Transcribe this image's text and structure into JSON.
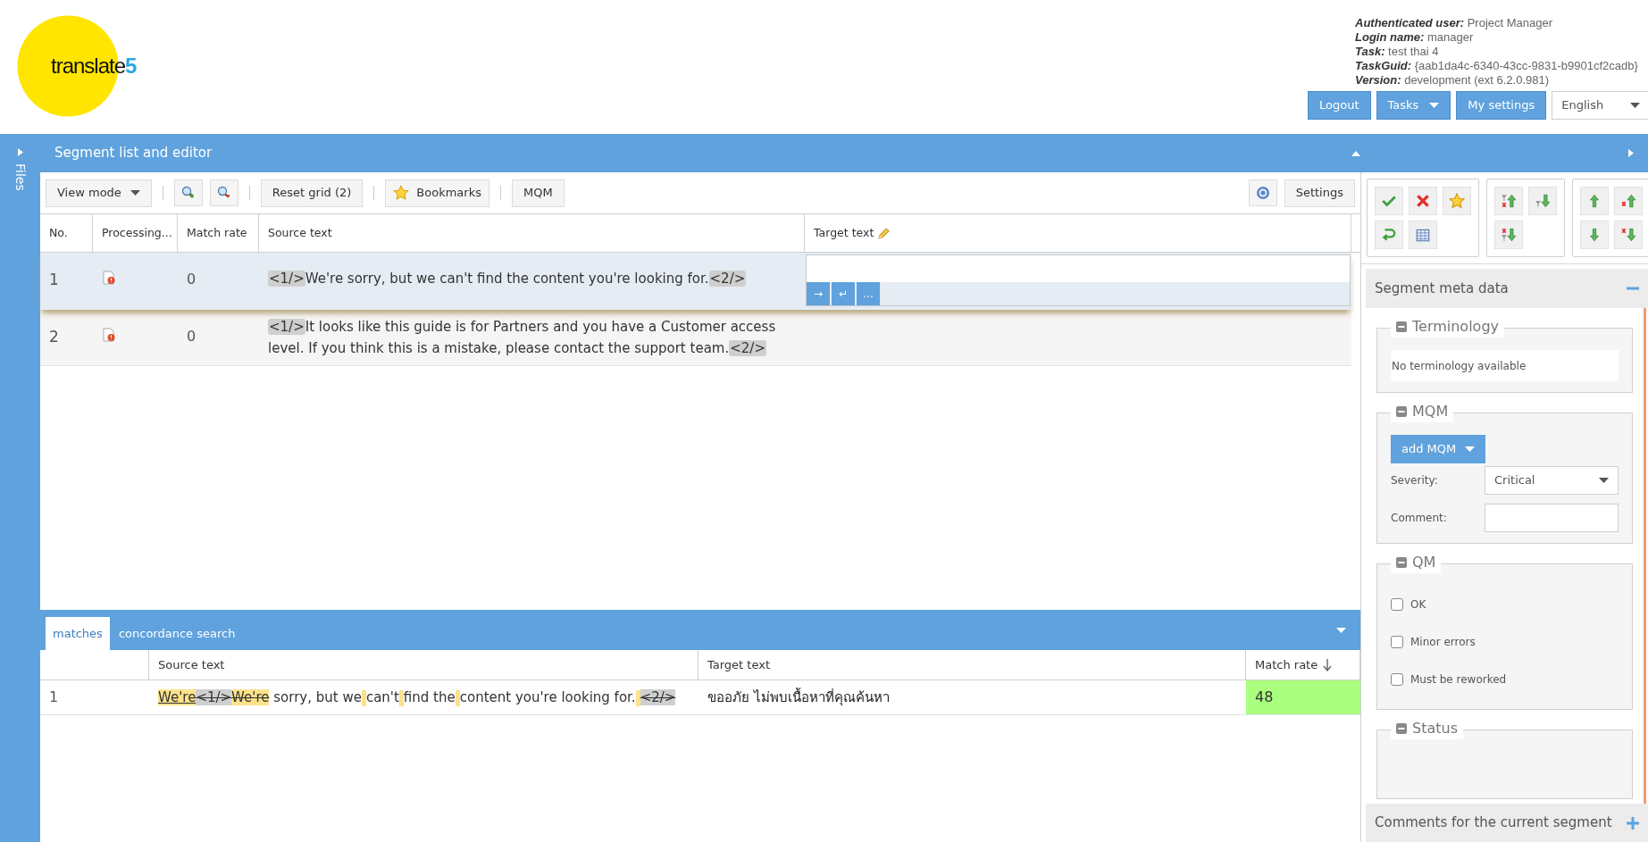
{
  "header": {
    "logo": {
      "word": "translate",
      "digit": "5"
    },
    "user_info": [
      {
        "label": "Authenticated user:",
        "value": "Project Manager"
      },
      {
        "label": "Login name:",
        "value": "manager"
      },
      {
        "label": "Task:",
        "value": "test thai 4"
      },
      {
        "label": "TaskGuid:",
        "value": "{aab1da4c-6340-43cc-9831-b9901cf2cadb}"
      },
      {
        "label": "Version:",
        "value": "development (ext 6.2.0.981)"
      }
    ],
    "buttons": [
      {
        "label": "Logout",
        "dropdown": false
      },
      {
        "label": "Tasks",
        "dropdown": true
      },
      {
        "label": "My settings",
        "dropdown": false
      }
    ],
    "language_select": {
      "value": "English"
    }
  },
  "files_sidebar": {
    "label": "Files",
    "expanded": false
  },
  "editor": {
    "title": "Segment list and editor",
    "toolbar": [
      {
        "kind": "dropdown",
        "label": "View mode"
      },
      {
        "kind": "separator"
      },
      {
        "kind": "zoom_in"
      },
      {
        "kind": "zoom_out"
      },
      {
        "kind": "separator"
      },
      {
        "kind": "text",
        "label": "Reset grid (2)"
      },
      {
        "kind": "separator"
      },
      {
        "kind": "star",
        "label": "Bookmarks"
      },
      {
        "kind": "separator"
      },
      {
        "kind": "text",
        "label": "MQM"
      }
    ],
    "toolbar_right": {
      "settings": "Settings"
    },
    "columns": [
      {
        "label": "No."
      },
      {
        "label": "Processing..."
      },
      {
        "label": "Match rate"
      },
      {
        "label": "Source text"
      },
      {
        "label": "Target text",
        "editable": true
      }
    ],
    "rows": [
      {
        "no": "1",
        "match_rate": "0",
        "selected": true,
        "source": [
          {
            "kind": "tag",
            "text": "<1/>"
          },
          {
            "kind": "text",
            "text": "We're sorry, but we can't find the content you're looking for."
          },
          {
            "kind": "tag",
            "text": "<2/>"
          }
        ],
        "editor_buttons": [
          "→",
          "↵",
          "…"
        ]
      },
      {
        "no": "2",
        "match_rate": "0",
        "selected": false,
        "source": [
          {
            "kind": "tag",
            "text": "<1/>"
          },
          {
            "kind": "text",
            "text": "It looks like this guide is for Partners and you have a Customer access level. If you think this is a mistake, please contact the support team."
          },
          {
            "kind": "tag",
            "text": "<2/>"
          }
        ]
      }
    ]
  },
  "matches_panel": {
    "tabs": [
      {
        "label": "matches",
        "selected": true
      },
      {
        "label": "concordance search",
        "selected": false
      }
    ],
    "columns": [
      {
        "label": "Source text"
      },
      {
        "label": "Target text"
      },
      {
        "label": "Match rate",
        "sorted": true
      }
    ],
    "rows": [
      {
        "no": "1",
        "source": [
          {
            "kind": "insert",
            "text": "We're"
          },
          {
            "kind": "deleted_tag",
            "text": "<1/>"
          },
          {
            "kind": "delete",
            "text": "We're"
          },
          {
            "kind": "text",
            "text": " sorry, but we"
          },
          {
            "kind": "insert_space"
          },
          {
            "kind": "text",
            "text": "can't"
          },
          {
            "kind": "insert_space"
          },
          {
            "kind": "text",
            "text": "find the"
          },
          {
            "kind": "insert_space"
          },
          {
            "kind": "text",
            "text": "content you're looking for."
          },
          {
            "kind": "insert_space"
          },
          {
            "kind": "deleted_tag",
            "text": "<2/>"
          }
        ],
        "target": "ขออภัย ไม่พบเนื้อหาที่คุณค้นหา",
        "match_rate": "48",
        "color": "#aaff7f"
      }
    ]
  },
  "right_panel": {
    "meta_title": "Segment meta data",
    "meta_expanded": true,
    "terminology": {
      "title": "Terminology",
      "text": "No terminology available"
    },
    "mqm": {
      "title": "MQM",
      "add_button": "add MQM",
      "severity_label": "Severity:",
      "severity_value": "Critical",
      "comment_label": "Comment:"
    },
    "qm": {
      "title": "QM",
      "options": [
        {
          "label": "OK",
          "checked": false
        },
        {
          "label": "Minor errors",
          "checked": false
        },
        {
          "label": "Must be reworked",
          "checked": false
        }
      ]
    },
    "status": {
      "title": "Status"
    },
    "comments_title": "Comments for the current segment"
  }
}
